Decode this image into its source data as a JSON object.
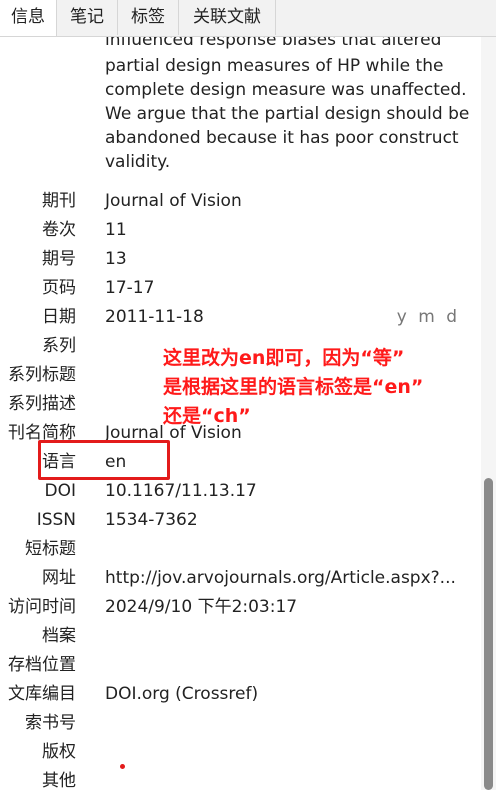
{
  "tabs": [
    "信息",
    "笔记",
    "标签",
    "关联文献"
  ],
  "abstract": {
    "cut_line": "influenced response biases that altered",
    "lines": "partial design measures of HP while the complete design measure was unaffected. We argue that the partial design should be abandoned because it has poor construct validity."
  },
  "fields": [
    {
      "label": "期刊",
      "value": "Journal of Vision"
    },
    {
      "label": "卷次",
      "value": "11"
    },
    {
      "label": "期号",
      "value": "13"
    },
    {
      "label": "页码",
      "value": "17-17"
    },
    {
      "label": "日期",
      "value": "2011-11-18",
      "extra": "y m d"
    },
    {
      "label": "系列",
      "value": ""
    },
    {
      "label": "系列标题",
      "value": ""
    },
    {
      "label": "系列描述",
      "value": ""
    },
    {
      "label": "刊名简称",
      "value": "Journal of Vision"
    },
    {
      "label": "语言",
      "value": "en"
    },
    {
      "label": "DOI",
      "value": "10.1167/11.13.17"
    },
    {
      "label": "ISSN",
      "value": "1534-7362"
    },
    {
      "label": "短标题",
      "value": ""
    },
    {
      "label": "网址",
      "value": "http://jov.arvojournals.org/Article.aspx?..."
    },
    {
      "label": "访问时间",
      "value": "2024/9/10 下午2:03:17"
    },
    {
      "label": "档案",
      "value": ""
    },
    {
      "label": "存档位置",
      "value": ""
    },
    {
      "label": "文库编目",
      "value": "DOI.org (Crossref)"
    },
    {
      "label": "索书号",
      "value": ""
    },
    {
      "label": "版权",
      "value": ""
    },
    {
      "label": "其他",
      "value": ""
    }
  ],
  "annotation": {
    "line1": "这里改为en即可，因为“等”",
    "line2": "是根据这里的语言标签是“en”",
    "line3": "还是“ch”"
  },
  "colors": {
    "annotation": "#e31b1b"
  }
}
